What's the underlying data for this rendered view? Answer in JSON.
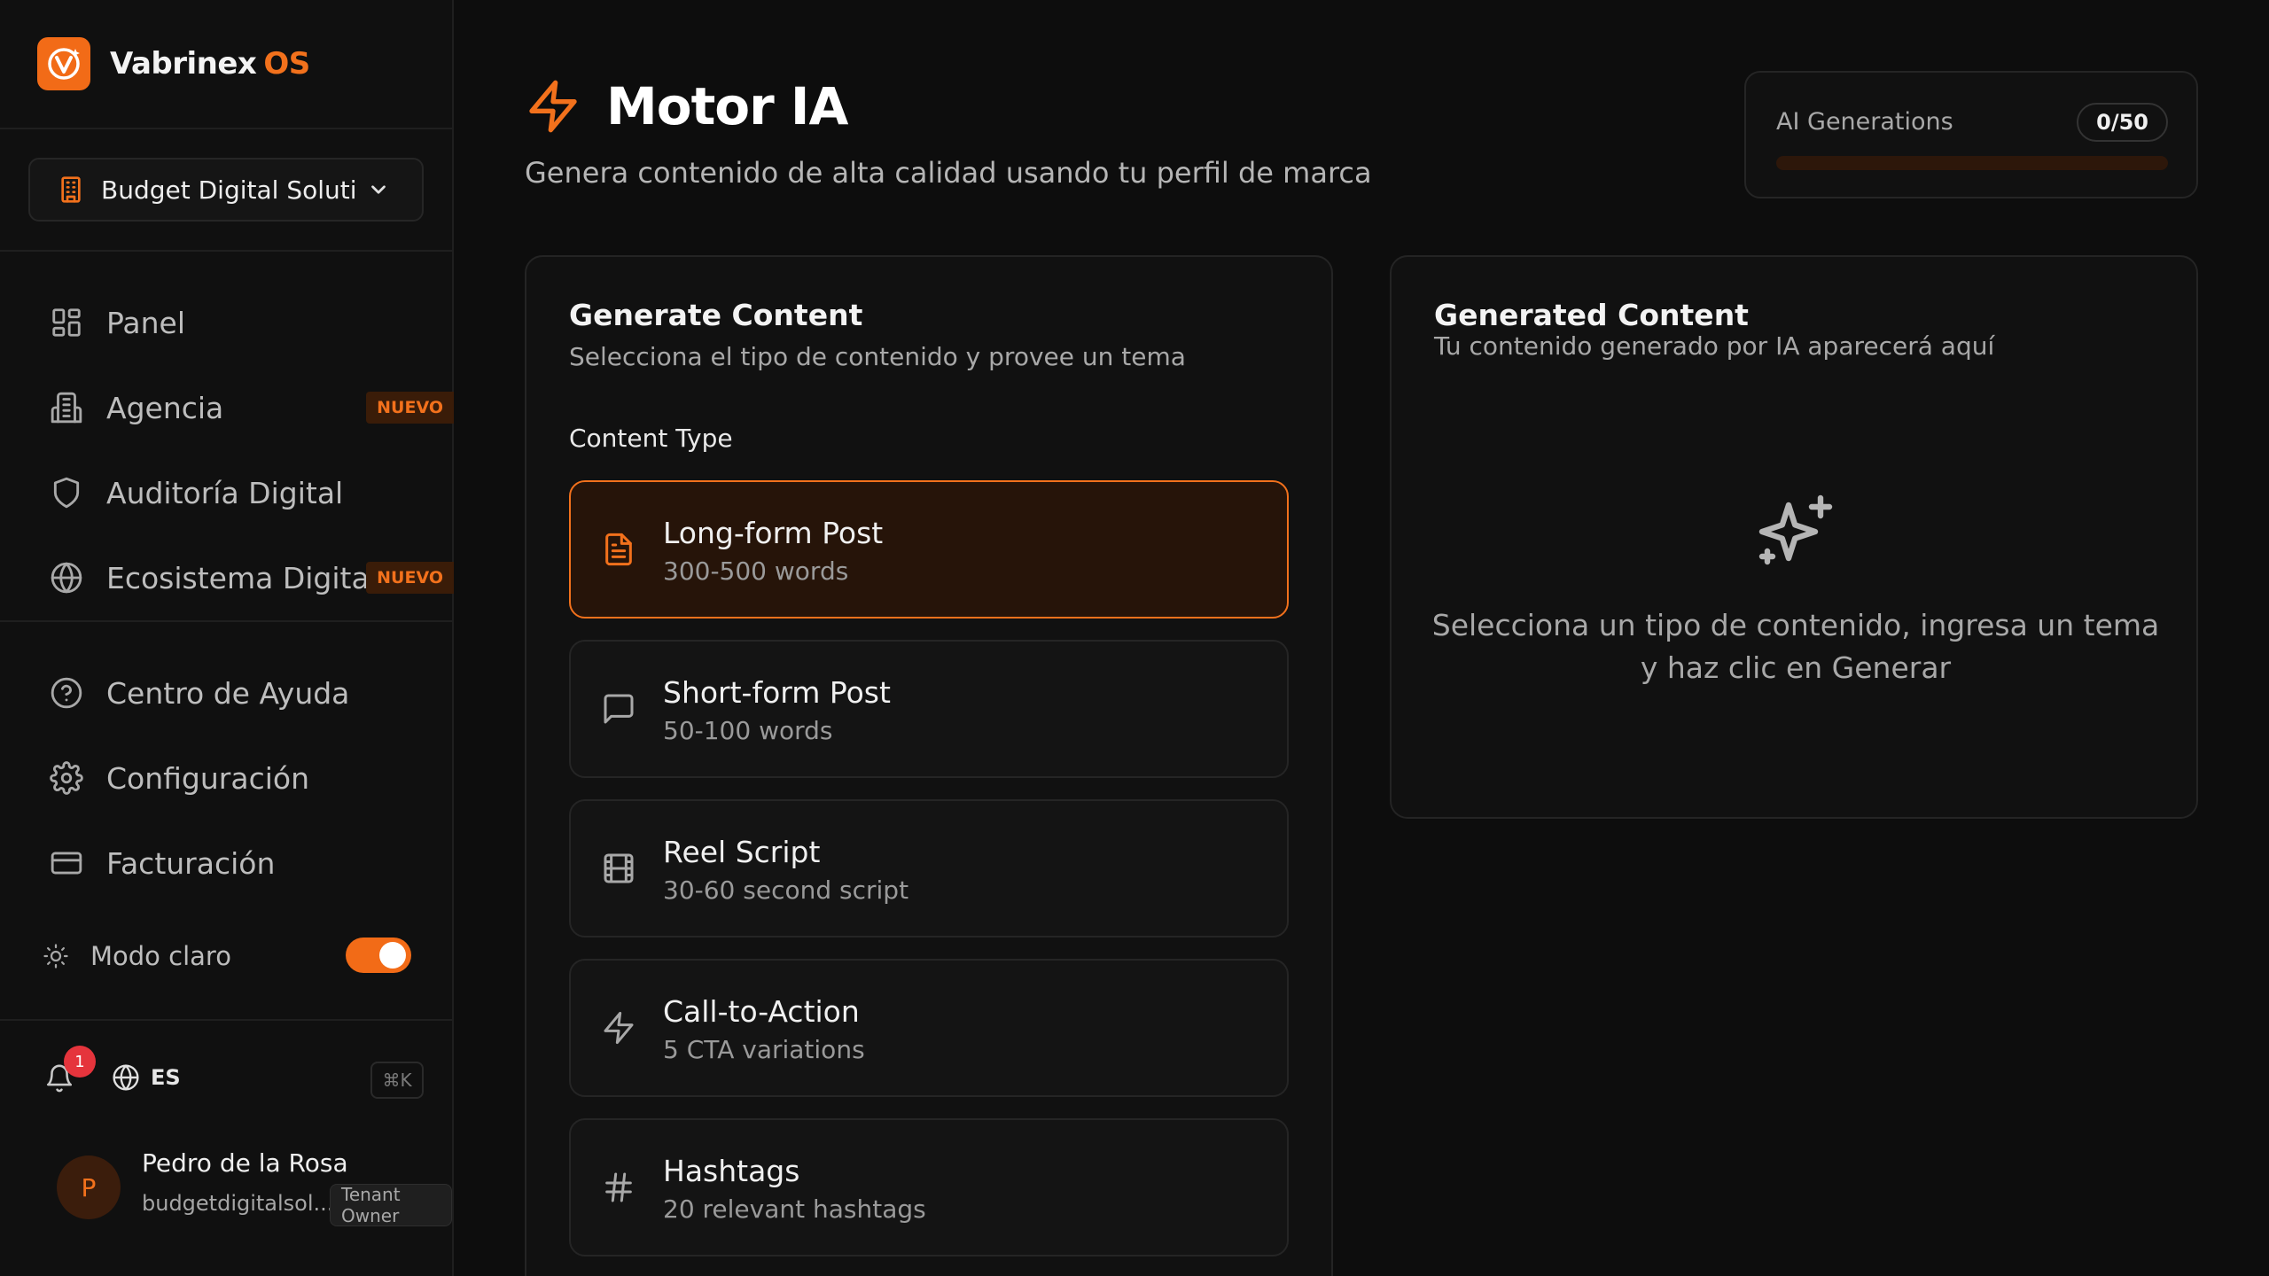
{
  "brand": {
    "name": "Vabrinex",
    "suffix": "OS",
    "accent": "#f26b17"
  },
  "tenant": {
    "name": "Budget Digital Soluti..."
  },
  "nav": {
    "items": [
      {
        "label": "Panel",
        "icon": "dashboard-icon"
      },
      {
        "label": "Agencia",
        "icon": "building-icon",
        "badge": "NUEVO"
      },
      {
        "label": "Auditoría Digital",
        "icon": "shield-icon"
      },
      {
        "label": "Ecosistema Digital",
        "icon": "globe-icon",
        "badge": "NUEVO"
      }
    ],
    "secondary": [
      {
        "label": "Centro de Ayuda",
        "icon": "help-circle-icon"
      },
      {
        "label": "Configuración",
        "icon": "gear-icon"
      },
      {
        "label": "Facturación",
        "icon": "credit-card-icon"
      }
    ]
  },
  "theme_toggle": {
    "label": "Modo claro",
    "on": true
  },
  "footer": {
    "notifications": "1",
    "language": "ES",
    "shortcut": "⌘K",
    "user": {
      "initial": "P",
      "name": "Pedro de la Rosa",
      "email": "budgetdigitalsol...",
      "role": "Tenant Owner"
    }
  },
  "header": {
    "title": "Motor IA",
    "subtitle": "Genera contenido de alta calidad usando tu perfil de marca"
  },
  "usage": {
    "label": "AI Generations",
    "count": "0/50",
    "used_fraction": 0
  },
  "generate": {
    "title": "Generate Content",
    "subtitle": "Selecciona el tipo de contenido y provee un tema",
    "section_label": "Content Type",
    "types": [
      {
        "name": "Long-form Post",
        "desc": "300-500 words",
        "icon": "document-icon",
        "selected": true
      },
      {
        "name": "Short-form Post",
        "desc": "50-100 words",
        "icon": "message-icon",
        "selected": false
      },
      {
        "name": "Reel Script",
        "desc": "30-60 second script",
        "icon": "film-icon",
        "selected": false
      },
      {
        "name": "Call-to-Action",
        "desc": "5 CTA variations",
        "icon": "lightning-icon",
        "selected": false
      },
      {
        "name": "Hashtags",
        "desc": "20 relevant hashtags",
        "icon": "hash-icon",
        "selected": false
      }
    ]
  },
  "output": {
    "title": "Generated Content",
    "subtitle": "Tu contenido generado por IA aparecerá aquí",
    "empty": "Selecciona un tipo de contenido, ingresa un tema y haz clic en Generar",
    "icon": "sparkles-icon"
  }
}
